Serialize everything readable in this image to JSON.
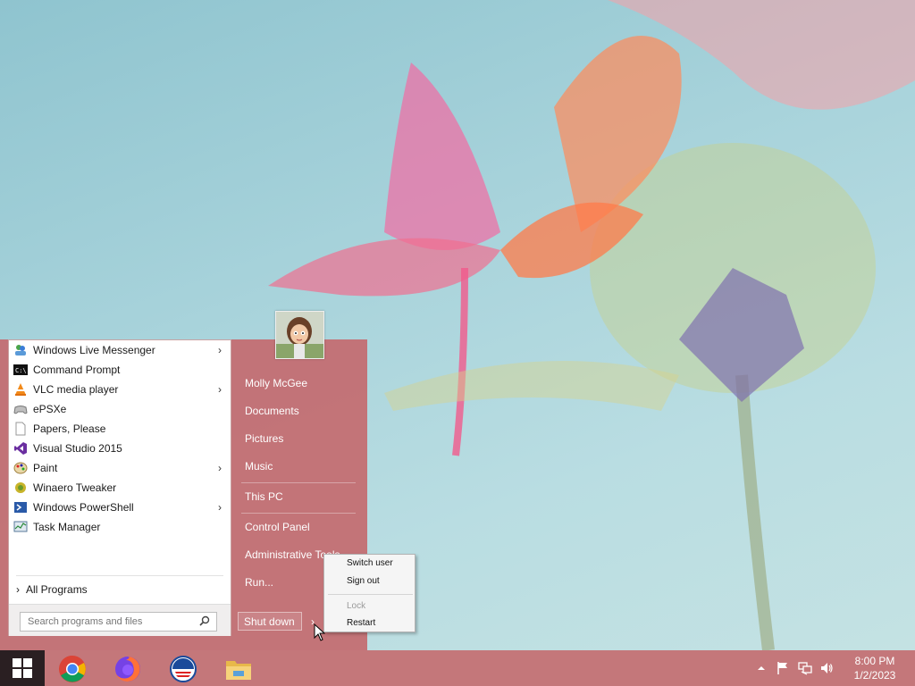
{
  "start_menu": {
    "programs": [
      {
        "label": "Windows Live Messenger",
        "icon": "messenger-icon",
        "has_submenu": true
      },
      {
        "label": "Command Prompt",
        "icon": "command-prompt-icon",
        "has_submenu": false
      },
      {
        "label": "VLC media player",
        "icon": "vlc-icon",
        "has_submenu": true
      },
      {
        "label": "ePSXe",
        "icon": "gamepad-icon",
        "has_submenu": false
      },
      {
        "label": "Papers, Please",
        "icon": "document-icon",
        "has_submenu": false
      },
      {
        "label": "Visual Studio 2015",
        "icon": "visual-studio-icon",
        "has_submenu": false
      },
      {
        "label": "Paint",
        "icon": "paint-palette-icon",
        "has_submenu": true
      },
      {
        "label": "Winaero Tweaker",
        "icon": "winaero-icon",
        "has_submenu": false
      },
      {
        "label": "Windows PowerShell",
        "icon": "powershell-icon",
        "has_submenu": true
      },
      {
        "label": "Task Manager",
        "icon": "task-manager-icon",
        "has_submenu": false
      }
    ],
    "all_programs_label": "All Programs",
    "search_placeholder": "Search programs and files",
    "user_name": "Molly McGee",
    "right_items": {
      "documents": "Documents",
      "pictures": "Pictures",
      "music": "Music",
      "this_pc": "This PC",
      "control_panel": "Control Panel",
      "admin_tools": "Administrative Tools",
      "run": "Run..."
    },
    "shutdown_label": "Shut down",
    "shutdown_arrow": "›"
  },
  "power_menu": {
    "switch_user": "Switch user",
    "sign_out": "Sign out",
    "lock": "Lock",
    "restart": "Restart"
  },
  "taskbar": {
    "pinned": [
      "chrome-icon",
      "firefox-icon",
      "opera-icon",
      "file-explorer-icon"
    ],
    "clock_time": "8:00 PM",
    "clock_date": "1/2/2023"
  },
  "colors": {
    "accent": "#c4777a",
    "start_panel": "#c46c70",
    "start_button": "#2a1f22"
  }
}
